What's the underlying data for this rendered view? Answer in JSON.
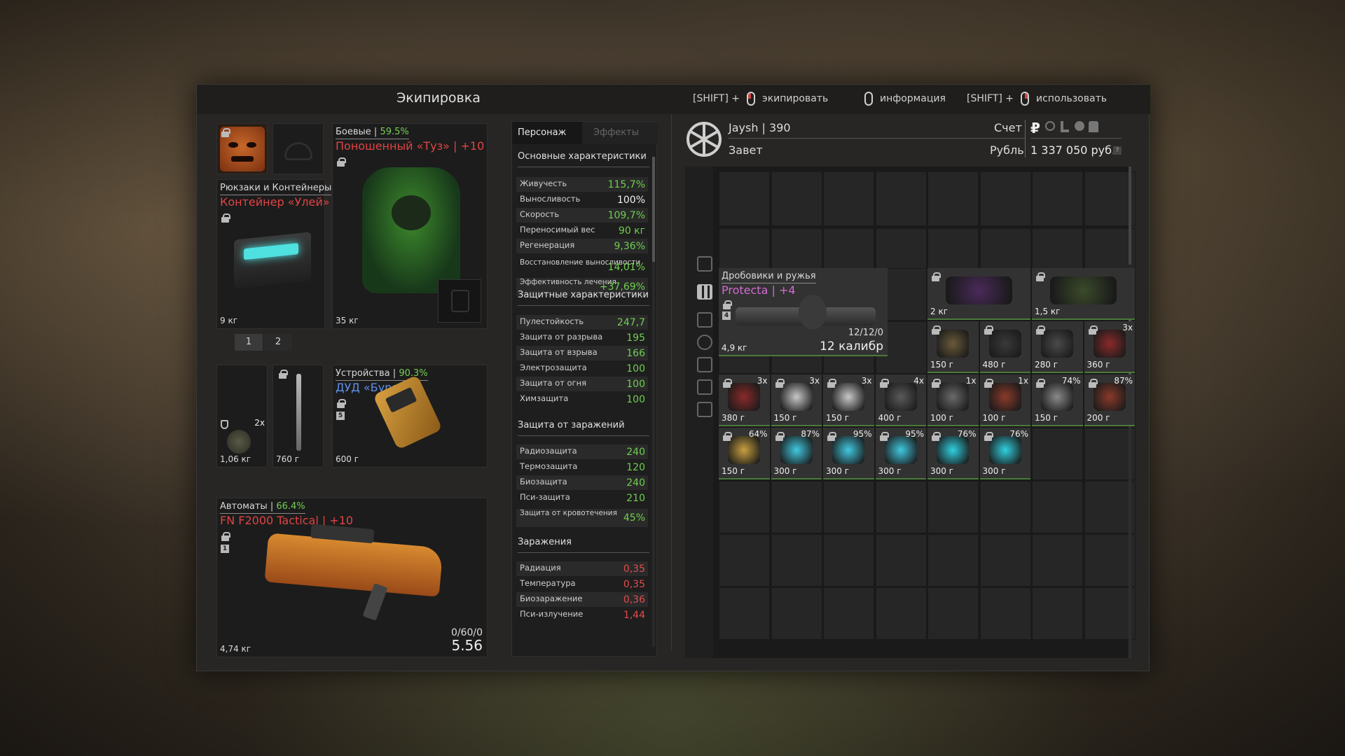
{
  "window": {
    "title": "Экипировка"
  },
  "hints": [
    {
      "prefix": "[SHIFT] +",
      "label": "экипировать"
    },
    {
      "prefix": "",
      "label": "информация"
    },
    {
      "prefix": "[SHIFT] +",
      "label": "использовать"
    }
  ],
  "armor": {
    "category": "Боевые",
    "percent": "59.5%",
    "name": "Поношенный «Туз» | +10",
    "weight": "35 кг"
  },
  "backpack": {
    "category": "Рюкзаки и Контейнеры",
    "name": "Контейнер «Улей»",
    "weight": "9 кг",
    "pages": [
      "1",
      "2"
    ]
  },
  "quick": {
    "grenade_qty": "2x",
    "grenade_weight": "1,06 кг",
    "knife_weight": "760 г"
  },
  "device": {
    "category": "Устройства",
    "percent": "90.3%",
    "name": "ДУД «Бурят»",
    "badge": "5",
    "weight": "600 г"
  },
  "rifle": {
    "category": "Автоматы",
    "percent": "66.4%",
    "name": "FN F2000 Tactical | +10",
    "badge": "1",
    "weight": "4,74 кг",
    "ammo_count": "0/60/0",
    "caliber": "5.56"
  },
  "stats": {
    "tabs": [
      "Персонаж",
      "Эффекты"
    ],
    "main_title": "Основные характеристики",
    "main": [
      {
        "k": "Живучесть",
        "v": "115,7%",
        "c": "g"
      },
      {
        "k": "Выносливость",
        "v": "100%",
        "c": "wh"
      },
      {
        "k": "Скорость",
        "v": "109,7%",
        "c": "g"
      },
      {
        "k": "Переносимый вес",
        "v": "90 кг",
        "c": "g"
      },
      {
        "k": "Регенерация",
        "v": "9,36%",
        "c": "g"
      },
      {
        "k": "Восстановление выносливости",
        "v": "14,01%",
        "c": "g"
      },
      {
        "k": "Эффективность лечения",
        "v": "+37,69%",
        "c": "g"
      }
    ],
    "prot_title": "Защитные характеристики",
    "prot": [
      {
        "k": "Пулестойкость",
        "v": "247,7"
      },
      {
        "k": "Защита от разрыва",
        "v": "195"
      },
      {
        "k": "Защита от взрыва",
        "v": "166"
      },
      {
        "k": "Электрозащита",
        "v": "100"
      },
      {
        "k": "Защита от огня",
        "v": "100"
      },
      {
        "k": "Химзащита",
        "v": "100"
      }
    ],
    "cont_title": "Защита от заражений",
    "cont": [
      {
        "k": "Радиозащита",
        "v": "240"
      },
      {
        "k": "Термозащита",
        "v": "120"
      },
      {
        "k": "Биозащита",
        "v": "240"
      },
      {
        "k": "Пси-защита",
        "v": "210"
      },
      {
        "k": "Защита от кровотечения",
        "v": "45%"
      }
    ],
    "inf_title": "Заражения",
    "inf": [
      {
        "k": "Радиация",
        "v": "0,35"
      },
      {
        "k": "Температура",
        "v": "0,35"
      },
      {
        "k": "Биозаражение",
        "v": "0,36"
      },
      {
        "k": "Пси-излучение",
        "v": "1,44"
      }
    ]
  },
  "player": {
    "name_level": "Jaysh | 390",
    "faction": "Завет",
    "account_label": "Счет",
    "currency_label": "Рубль",
    "money": "1 337 050 руб.",
    "currency_symbol": "₽"
  },
  "shotgun": {
    "category": "Дробовики и ружья",
    "name": "Protecta | +4",
    "badge": "4",
    "weight": "4,9 кг",
    "ammo_count": "12/12/0",
    "caliber": "12 калибр"
  },
  "items": [
    {
      "w": "2 кг",
      "q": "",
      "col": 4,
      "row": 0,
      "cw": 2
    },
    {
      "w": "1,5 кг",
      "q": "",
      "col": 6,
      "row": 0,
      "cw": 2
    },
    {
      "w": "150 г",
      "q": "",
      "col": 4,
      "row": 1
    },
    {
      "w": "480 г",
      "q": "",
      "col": 5,
      "row": 1
    },
    {
      "w": "280 г",
      "q": "",
      "col": 6,
      "row": 1
    },
    {
      "w": "360 г",
      "q": "3x",
      "col": 7,
      "row": 1
    },
    {
      "w": "380 г",
      "q": "3x",
      "col": 0,
      "row": 2
    },
    {
      "w": "150 г",
      "q": "3x",
      "col": 1,
      "row": 2
    },
    {
      "w": "150 г",
      "q": "3x",
      "col": 2,
      "row": 2
    },
    {
      "w": "400 г",
      "q": "4x",
      "col": 3,
      "row": 2
    },
    {
      "w": "100 г",
      "q": "1x",
      "col": 4,
      "row": 2
    },
    {
      "w": "100 г",
      "q": "1x",
      "col": 5,
      "row": 2
    },
    {
      "w": "150 г",
      "q": "74%",
      "col": 6,
      "row": 2
    },
    {
      "w": "200 г",
      "q": "87%",
      "col": 7,
      "row": 2
    },
    {
      "w": "150 г",
      "q": "64%",
      "col": 0,
      "row": 3
    },
    {
      "w": "300 г",
      "q": "87%",
      "col": 1,
      "row": 3
    },
    {
      "w": "300 г",
      "q": "95%",
      "col": 2,
      "row": 3
    },
    {
      "w": "300 г",
      "q": "95%",
      "col": 3,
      "row": 3
    },
    {
      "w": "300 г",
      "q": "76%",
      "col": 4,
      "row": 3
    },
    {
      "w": "300 г",
      "q": "76%",
      "col": 5,
      "row": 3
    }
  ],
  "colors": {
    "accent_green": "#6fcf4f",
    "accent_red": "#e04c4c",
    "accent_blue": "#5f8fe8",
    "accent_pink": "#d26bd2"
  }
}
